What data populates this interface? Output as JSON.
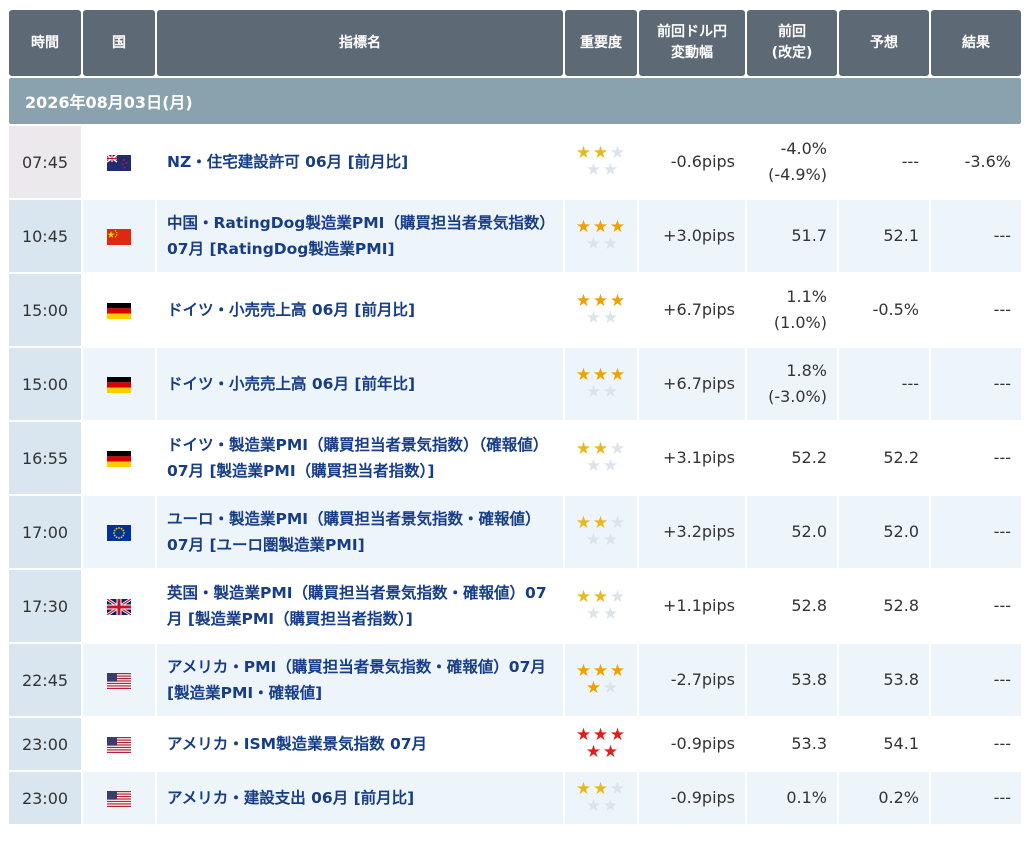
{
  "header": {
    "time": "時間",
    "country": "国",
    "indicator": "指標名",
    "importance": "重要度",
    "prev_change_l1": "前回ドル円",
    "prev_change_l2": "変動幅",
    "prev_l1": "前回",
    "prev_l2": "(改定)",
    "forecast": "予想",
    "result": "結果"
  },
  "date_label": "2026年08月03日(月)",
  "events": [
    {
      "time": "07:45",
      "flag": "nz-flag-icon",
      "name": "NZ・住宅建設許可 06月 [前月比]",
      "stars": 2,
      "star_color": "yellow",
      "pips": "-0.6pips",
      "prev": "-4.0%",
      "revised": "(-4.9%)",
      "forecast": "---",
      "result": "-3.6%"
    },
    {
      "time": "10:45",
      "flag": "china-flag-icon",
      "name": "中国・RatingDog製造業PMI（購買担当者景気指数）07月 [RatingDog製造業PMI]",
      "stars": 3,
      "star_color": "orange",
      "pips": "+3.0pips",
      "prev": "51.7",
      "revised": "",
      "forecast": "52.1",
      "result": "---"
    },
    {
      "time": "15:00",
      "flag": "germany-flag-icon",
      "name": "ドイツ・小売売上高 06月 [前月比]",
      "stars": 3,
      "star_color": "orange",
      "pips": "+6.7pips",
      "prev": "1.1%",
      "revised": "(1.0%)",
      "forecast": "-0.5%",
      "result": "---"
    },
    {
      "time": "15:00",
      "flag": "germany-flag-icon",
      "name": "ドイツ・小売売上高 06月 [前年比]",
      "stars": 3,
      "star_color": "orange",
      "pips": "+6.7pips",
      "prev": "1.8%",
      "revised": "(-3.0%)",
      "forecast": "---",
      "result": "---"
    },
    {
      "time": "16:55",
      "flag": "germany-flag-icon",
      "name": "ドイツ・製造業PMI（購買担当者景気指数）（確報値）07月 [製造業PMI（購買担当者指数）]",
      "stars": 2,
      "star_color": "yellow",
      "pips": "+3.1pips",
      "prev": "52.2",
      "revised": "",
      "forecast": "52.2",
      "result": "---"
    },
    {
      "time": "17:00",
      "flag": "eu-flag-icon",
      "name": "ユーロ・製造業PMI（購買担当者景気指数・確報値）07月 [ユーロ圏製造業PMI]",
      "stars": 2,
      "star_color": "yellow",
      "pips": "+3.2pips",
      "prev": "52.0",
      "revised": "",
      "forecast": "52.0",
      "result": "---"
    },
    {
      "time": "17:30",
      "flag": "uk-flag-icon",
      "name": "英国・製造業PMI（購買担当者景気指数・確報値）07月 [製造業PMI（購買担当者指数）]",
      "stars": 2,
      "star_color": "yellow",
      "pips": "+1.1pips",
      "prev": "52.8",
      "revised": "",
      "forecast": "52.8",
      "result": "---"
    },
    {
      "time": "22:45",
      "flag": "us-flag-icon",
      "name": "アメリカ・PMI（購買担当者景気指数・確報値）07月 [製造業PMI・確報値]",
      "stars": 4,
      "star_color": "orange",
      "pips": "-2.7pips",
      "prev": "53.8",
      "revised": "",
      "forecast": "53.8",
      "result": "---"
    },
    {
      "time": "23:00",
      "flag": "us-flag-icon",
      "name": "アメリカ・ISM製造業景気指数 07月",
      "stars": 5,
      "star_color": "red",
      "pips": "-0.9pips",
      "prev": "53.3",
      "revised": "",
      "forecast": "54.1",
      "result": "---"
    },
    {
      "time": "23:00",
      "flag": "us-flag-icon",
      "name": "アメリカ・建設支出 06月 [前月比]",
      "stars": 2,
      "star_color": "yellow",
      "pips": "-0.9pips",
      "prev": "0.1%",
      "revised": "",
      "forecast": "0.2%",
      "result": "---"
    }
  ]
}
